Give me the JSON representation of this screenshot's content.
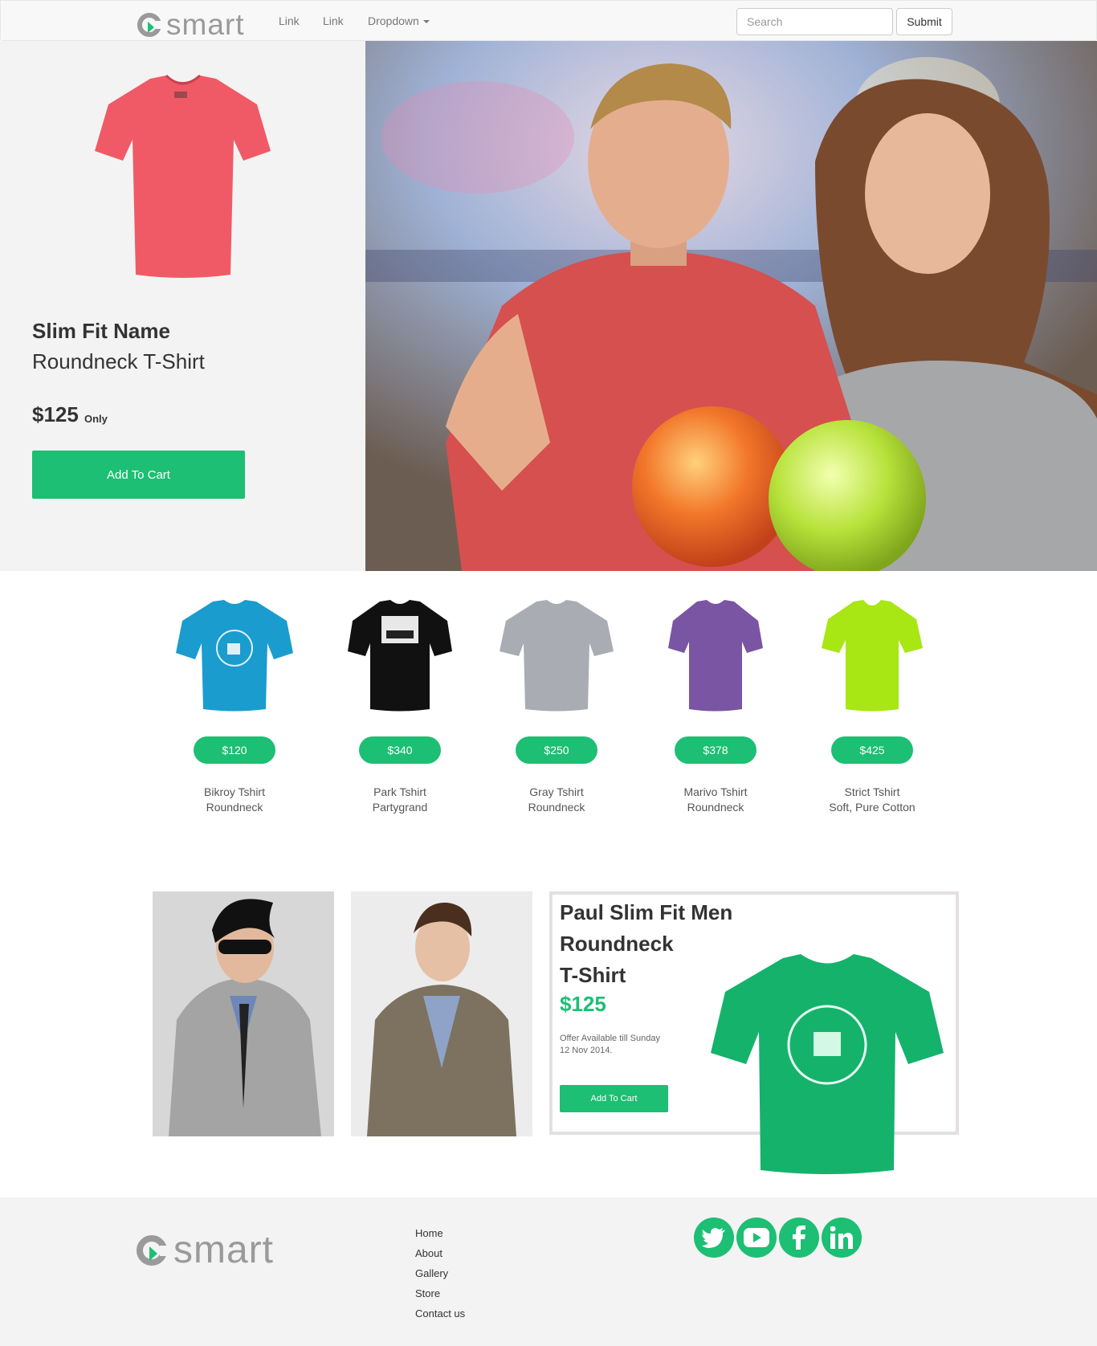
{
  "nav": {
    "brand": "smart",
    "links": [
      "Link",
      "Link"
    ],
    "dropdown_label": "Dropdown",
    "search_placeholder": "Search",
    "submit_label": "Submit"
  },
  "hero": {
    "title": "Slim Fit Name",
    "subtitle": "Roundneck T-Shirt",
    "price": "$125",
    "price_note": "Only",
    "button_label": "Add To Cart",
    "shirt_color": "#f05a66"
  },
  "products": [
    {
      "price": "$120",
      "name": "Bikroy Tshirt",
      "detail": "Roundneck",
      "color": "#1a9cce"
    },
    {
      "price": "$340",
      "name": "Park Tshirt",
      "detail": "Partygrand",
      "color": "#111111"
    },
    {
      "price": "$250",
      "name": "Gray Tshirt",
      "detail": "Roundneck",
      "color": "#a9acb3"
    },
    {
      "price": "$378",
      "name": "Marivo Tshirt",
      "detail": "Roundneck",
      "color": "#7a55a3"
    },
    {
      "price": "$425",
      "name": "Strict Tshirt",
      "detail": "Soft, Pure Cotton",
      "color": "#a8e614"
    }
  ],
  "promo": {
    "title_lines": [
      "Paul Slim Fit Men",
      "Roundneck",
      "T-Shirt"
    ],
    "price": "$125",
    "offer": "Offer Available till Sunday 12 Nov 2014.",
    "button_label": "Add To Cart",
    "shirt_color": "#15b26c"
  },
  "footer": {
    "brand": "smart",
    "links": [
      "Home",
      "About",
      "Gallery",
      "Store",
      "Contact us"
    ],
    "social_icons": [
      "twitter-icon",
      "youtube-icon",
      "facebook-icon",
      "linkedin-icon"
    ]
  },
  "colors": {
    "accent": "#1cbf73"
  }
}
